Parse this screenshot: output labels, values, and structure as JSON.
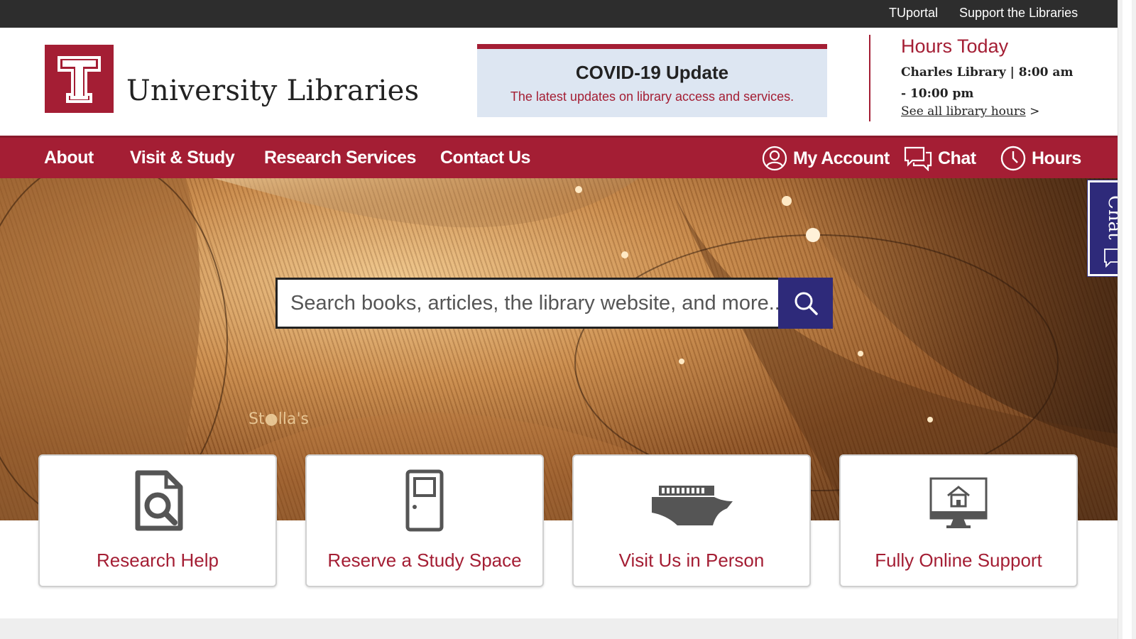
{
  "utility": {
    "tuportal": "TUportal",
    "support": "Support the Libraries"
  },
  "header": {
    "logo_icon": "temple-t-logo",
    "site_name": "University Libraries"
  },
  "covid": {
    "title": "COVID-19 Update",
    "subtitle": "The latest updates on library access and services."
  },
  "hours": {
    "title": "Hours Today",
    "detail": "Charles Library | 8:00 am - 10:00 pm",
    "link_text": "See all library hours",
    "link_suffix": " >"
  },
  "nav": {
    "items": [
      "About",
      "Visit & Study",
      "Research Services",
      "Contact Us"
    ],
    "account": "My Account",
    "chat": "Chat",
    "hours": "Hours"
  },
  "search": {
    "placeholder": "Search books, articles, the library website, and more..."
  },
  "side_chat": {
    "label": "Chat"
  },
  "cards": [
    {
      "label": "Research Help",
      "icon": "document-search-icon"
    },
    {
      "label": "Reserve a Study Space",
      "icon": "door-icon"
    },
    {
      "label": "Visit Us in Person",
      "icon": "library-building-icon"
    },
    {
      "label": "Fully Online Support",
      "icon": "monitor-home-icon"
    }
  ],
  "colors": {
    "brand_red": "#a41e34",
    "navy": "#2e2a7a",
    "dark_bar": "#2d2d2d",
    "covid_bg": "#dde6f2"
  }
}
